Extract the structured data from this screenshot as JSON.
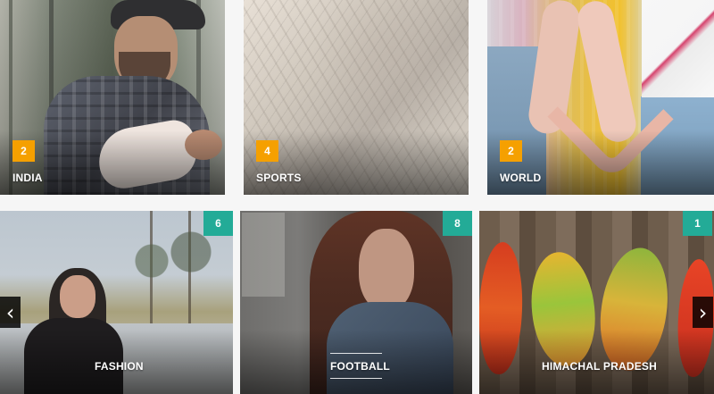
{
  "cards": [
    {
      "label": "INDIA",
      "count": "2"
    },
    {
      "label": "SPORTS",
      "count": "4"
    },
    {
      "label": "WORLD",
      "count": "2"
    },
    {
      "label": "FASHION",
      "count": "6"
    },
    {
      "label": "FOOTBALL",
      "count": "8"
    },
    {
      "label": "HIMACHAL PRADESH",
      "count": "1"
    }
  ],
  "controls": {
    "prev_icon": "‹",
    "next_icon": "›"
  },
  "colors": {
    "orange_badge": "#f5a000",
    "teal_badge": "#23ab97",
    "arrow_bg": "#111111"
  }
}
